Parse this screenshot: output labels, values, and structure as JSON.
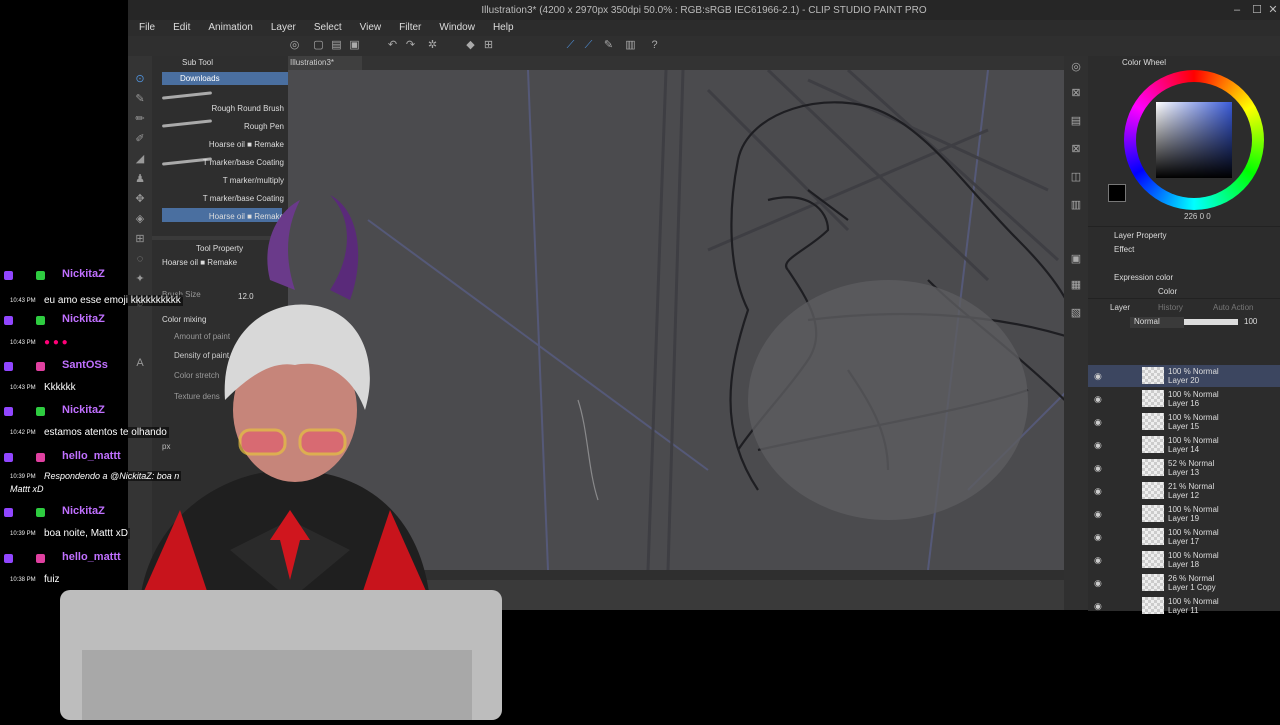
{
  "window": {
    "title": "Illustration3* (4200 x 2970px 350dpi 50.0% : RGB:sRGB IEC61966-2.1) - CLIP STUDIO PAINT PRO",
    "minimize": "–",
    "maximize": "☐",
    "close": "✕"
  },
  "menu": [
    "File",
    "Edit",
    "Animation",
    "Layer",
    "Select",
    "View",
    "Filter",
    "Window",
    "Help"
  ],
  "subtool": {
    "header": "Sub Tool",
    "group": "Downloads",
    "items": [
      "Rough Round Brush",
      "Rough Pen",
      "Hoarse oil ■ Remake",
      "T marker/base Coating",
      "T marker/multiply",
      "T marker/base Coating",
      "Hoarse oil ■ Remake"
    ]
  },
  "toolprop": {
    "header": "Tool Property",
    "brush": "Hoarse oil ■ Remake",
    "size_label": "Brush Size",
    "size_value": "12.0",
    "color_mixing": "Color mixing",
    "amount": "Amount of paint",
    "density": "Density of paint",
    "stretch": "Color stretch",
    "texture": "Texture dens",
    "px": "px"
  },
  "canvas": {
    "tab": "Illustration3*"
  },
  "colorwheel": {
    "header": "Color Wheel",
    "readout": "226 0 0"
  },
  "layerprop": {
    "header": "Layer Property",
    "effect": "Effect",
    "expression": "Expression color",
    "color": "Color"
  },
  "layers": {
    "tab": "Layer",
    "tab2": "History",
    "tab3": "Auto Action",
    "blend": "Normal",
    "opacity": "100",
    "rows": [
      {
        "mode": "100 % Normal",
        "name": "Layer 20"
      },
      {
        "mode": "100 % Normal",
        "name": "Layer 16"
      },
      {
        "mode": "100 % Normal",
        "name": "Layer 15"
      },
      {
        "mode": "100 % Normal",
        "name": "Layer 14"
      },
      {
        "mode": "52 % Normal",
        "name": "Layer 13"
      },
      {
        "mode": "21 % Normal",
        "name": "Layer 12"
      },
      {
        "mode": "100 % Normal",
        "name": "Layer 19"
      },
      {
        "mode": "100 % Normal",
        "name": "Layer 17"
      },
      {
        "mode": "100 % Normal",
        "name": "Layer 18"
      },
      {
        "mode": "26 % Normal",
        "name": "Layer 1 Copy"
      },
      {
        "mode": "100 % Normal",
        "name": "Layer 11"
      }
    ]
  },
  "chat": [
    {
      "user": "NickitaZ",
      "time": "10:43 PM",
      "text": "eu amo esse emoji kkkkkkkkkk"
    },
    {
      "user": "NickitaZ",
      "time": "10:43 PM",
      "text": "● ● ●"
    },
    {
      "user": "SantOSs",
      "time": "10:43 PM",
      "text": "Kkkkkk"
    },
    {
      "user": "NickitaZ",
      "time": "10:42 PM",
      "text": "estamos atentos te olhando"
    },
    {
      "user": "hello_mattt",
      "time": "10:39 PM",
      "text": "Respondendo a @NickitaZ: boa n",
      "text2": "Mattt xD"
    },
    {
      "user": "NickitaZ",
      "time": "10:39 PM",
      "text": "boa noite, Mattt xD"
    },
    {
      "user": "hello_mattt",
      "time": "10:38 PM",
      "text": "fuiz"
    }
  ],
  "colors": {
    "accent": "#4f8fd6",
    "username": "#b86bff",
    "badge_green": "#2ecc40",
    "badge_purple": "#9146ff"
  }
}
